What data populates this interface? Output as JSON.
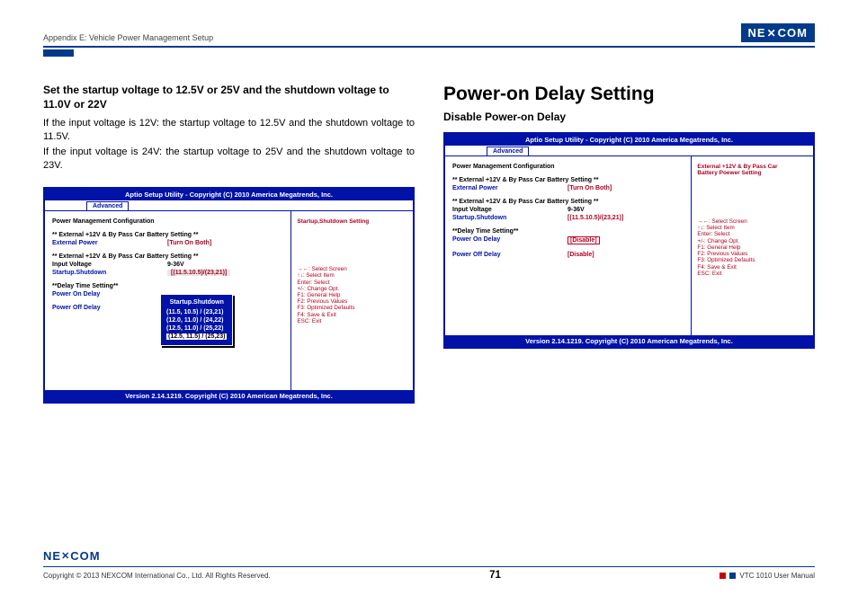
{
  "header": {
    "appendix": "Appendix E: Vehicle Power Management Setup",
    "logo": "NEXCOM"
  },
  "left": {
    "title": "Set the startup voltage to 12.5V or 25V and the shutdown voltage to 11.0V or 22V",
    "p1": "If the input voltage is 12V: the startup voltage to 12.5V and the shutdown voltage to 11.5V.",
    "p2": "If the input voltage is 24V: the startup voltage to 25V and the shutdown voltage to 23V.",
    "bios": {
      "hdr": "Aptio Setup Utility - Copyright (C) 2010 America Megatrends, Inc.",
      "tab": "Advanced",
      "sec": "Power Management Configuration",
      "banner1": "** External +12V & By Pass Car Battery Setting **",
      "row_ext_power_k": "External Power",
      "row_ext_power_v": "[Turn On Both]",
      "banner2": "** External +12V & By Pass Car Battery Setting **",
      "row_iv_k": "Input Voltage",
      "row_iv_v": "9-36V",
      "row_ss_k": "Startup.Shutdown",
      "row_ss_v": "[(11.5.10.5)/(23,21)]",
      "delay_hdr": "**Delay Time Setting**",
      "pon": "Power On Delay",
      "poff": "Power Off Delay",
      "popup": {
        "title": "Startup.Shutdown",
        "o1": "(11.5, 10.5) / (23,21)",
        "o2": "(12.0, 11.0) / (24,22)",
        "o3": "(12.5, 11.0) / (25,22)",
        "o4": "(12.5, 11.5) / (25,23)"
      },
      "right_title": "Startup,Shutdown Setting",
      "help": {
        "l1": "→←: Select Screen",
        "l2": "↑↓: Select Item",
        "l3": "Enter: Select",
        "l4": "+/-: Change Opt.",
        "l5": "F1: General Help",
        "l6": "F2: Previous Values",
        "l7": "F3: Optimized Defaults",
        "l8": "F4: Save & Exit",
        "l9": "ESC: Exit"
      },
      "ftr": "Version 2.14.1219. Copyright (C) 2010 American Megatrends, Inc."
    }
  },
  "right": {
    "h1": "Power-on Delay Setting",
    "h2": "Disable Power-on Delay",
    "bios": {
      "hdr": "Aptio Setup Utility - Copyright (C) 2010 America Megatrends, Inc.",
      "tab": "Advanced",
      "sec": "Power Management Configuration",
      "banner1": "** External +12V & By Pass Car Battery Setting **",
      "row_ext_power_k": "External Power",
      "row_ext_power_v": "[Turn On Both]",
      "banner2": "** External +12V & By Pass Car Battery Setting **",
      "row_iv_k": "Input Voltage",
      "row_iv_v": "9-36V",
      "row_ss_k": "Startup.Shutdown",
      "row_ss_v": "[(11.5.10.5)/(23,21)]",
      "delay_hdr": "**Delay Time Setting**",
      "pon_k": "Power On Delay",
      "pon_v": "[Disable]",
      "poff_k": "Power Off Delay",
      "poff_v": "[Disable]",
      "right_title1": "External +12V & By Pass Car",
      "right_title2": "Battery Poewer Setting",
      "help": {
        "l1": "→←: Select Screen",
        "l2": "↑↓: Select Item",
        "l3": "Enter: Select",
        "l4": "+/-: Change Opt.",
        "l5": "F1: General Help",
        "l6": "F2: Previous Values",
        "l7": "F3: Optimized Defaults",
        "l8": "F4: Save & Exit",
        "l9": "ESC: Exit"
      },
      "ftr": "Version 2.14.1219. Copyright (C) 2010 American Megatrends, Inc."
    }
  },
  "footer": {
    "logo": "NEXCOM",
    "copyright": "Copyright © 2013 NEXCOM International Co., Ltd. All Rights Reserved.",
    "page": "71",
    "doc": "VTC 1010 User Manual"
  }
}
